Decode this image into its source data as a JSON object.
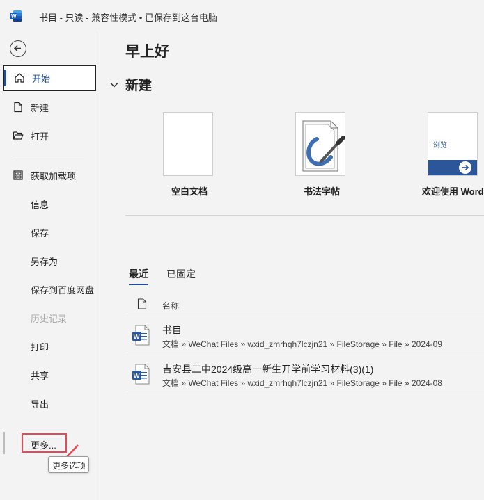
{
  "titlebar": {
    "app_icon": "word-logo-icon",
    "title": "书目 - 只读 - 兼容性模式 • 已保存到这台电脑"
  },
  "sidebar": {
    "back_icon": "back-arrow-icon",
    "items": [
      {
        "label": "开始",
        "icon": "home-icon",
        "selected": true
      },
      {
        "label": "新建",
        "icon": "new-document-icon"
      },
      {
        "label": "打开",
        "icon": "folder-open-icon"
      },
      {
        "label": "获取加载项",
        "icon": "addins-grid-icon"
      },
      {
        "label": "信息"
      },
      {
        "label": "保存"
      },
      {
        "label": "另存为"
      },
      {
        "label": "保存到百度网盘"
      },
      {
        "label": "历史记录",
        "disabled": true
      },
      {
        "label": "打印"
      },
      {
        "label": "共享"
      },
      {
        "label": "导出"
      }
    ],
    "more": {
      "label": "更多...",
      "tooltip": "更多选项"
    }
  },
  "main": {
    "greeting": "早上好",
    "new_section": {
      "heading": "新建",
      "templates": [
        {
          "label": "空白文档"
        },
        {
          "label": "书法字帖"
        },
        {
          "label": "欢迎使用 Word",
          "thumb_text": "浏览"
        }
      ]
    },
    "tabs": [
      {
        "label": "最近",
        "active": true
      },
      {
        "label": "已固定"
      }
    ],
    "list": {
      "header_name": "名称",
      "files": [
        {
          "name": "书目",
          "path": "文档 » WeChat Files » wxid_zmrhqh7lczjn21 » FileStorage » File » 2024-09"
        },
        {
          "name": "吉安县二中2024级高一新生开学前学习材料(3)(1)",
          "path": "文档 » WeChat Files » wxid_zmrhqh7lczjn21 » FileStorage » File » 2024-08"
        }
      ]
    }
  },
  "colors": {
    "accent": "#1e4e9c",
    "word_blue": "#2b579a",
    "annotation_red": "#e64856"
  }
}
